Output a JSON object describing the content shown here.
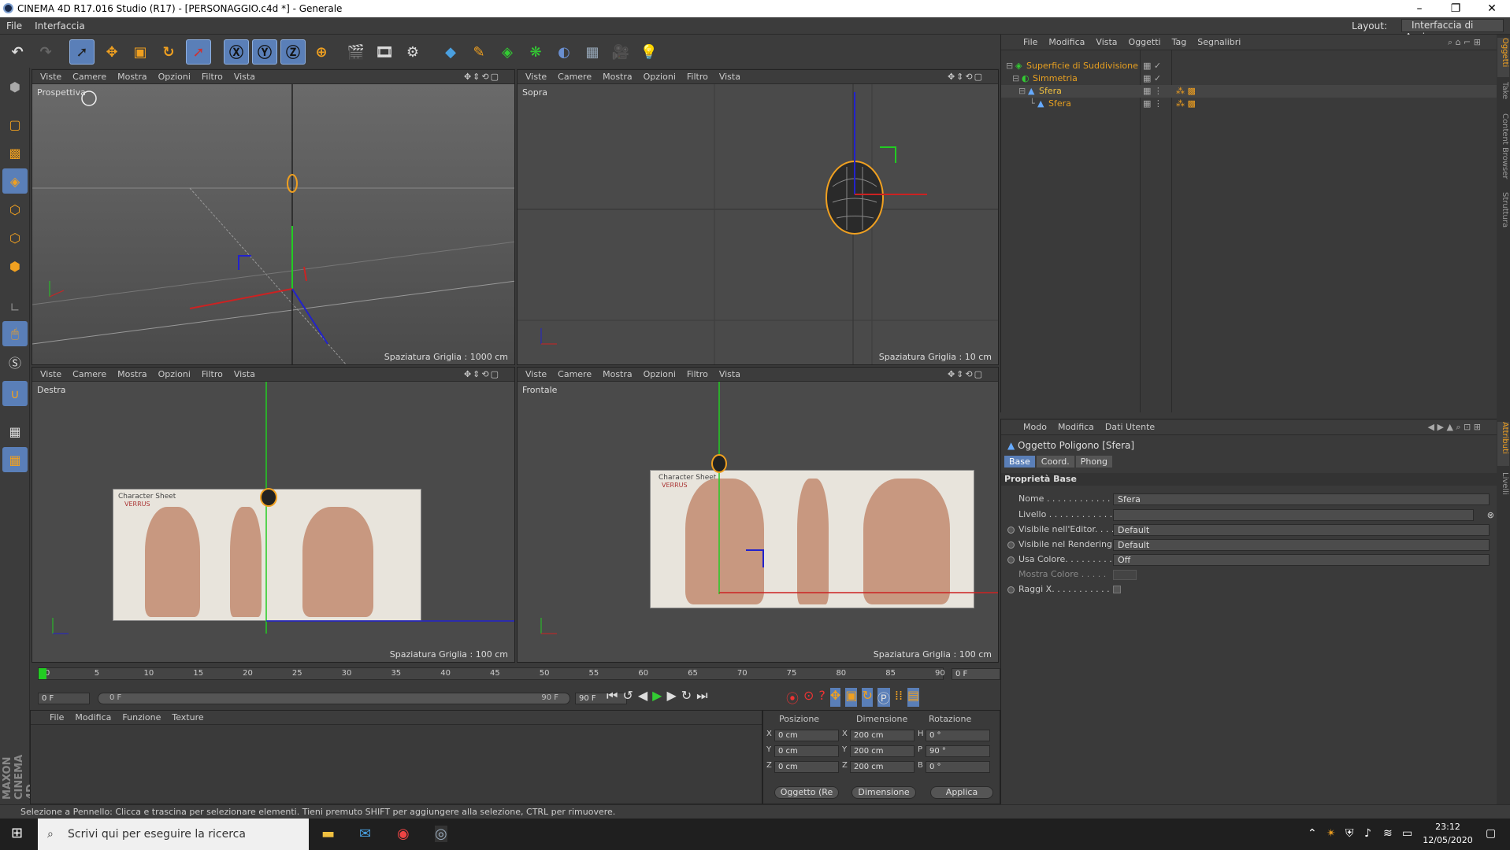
{
  "window": {
    "title": "CINEMA 4D R17.016 Studio (R17) - [PERSONAGGIO.c4d *] - Generale"
  },
  "menubar": {
    "items": [
      "File",
      "Interfaccia"
    ],
    "layout_label": "Layout:",
    "layout_value": "Interfaccia di Avvio"
  },
  "viewport_menu": [
    "Viste",
    "Camere",
    "Mostra",
    "Opzioni",
    "Filtro",
    "Vista"
  ],
  "viewports": {
    "tl": {
      "name": "Prospettiva",
      "grid": "Spaziatura Griglia : 1000 cm"
    },
    "tr": {
      "name": "Sopra",
      "grid": "Spaziatura Griglia : 10 cm"
    },
    "bl": {
      "name": "Destra",
      "grid": "Spaziatura Griglia : 100 cm"
    },
    "br": {
      "name": "Frontale",
      "grid": "Spaziatura Griglia : 100 cm"
    }
  },
  "objects_menu": [
    "File",
    "Modifica",
    "Vista",
    "Oggetti",
    "Tag",
    "Segnalibri"
  ],
  "objects": [
    {
      "name": "Superficie di Suddivisione",
      "color": "#e8a020",
      "indent": 0
    },
    {
      "name": "Simmetria",
      "color": "#e8a020",
      "indent": 1
    },
    {
      "name": "Sfera",
      "color": "#f0c040",
      "indent": 2
    },
    {
      "name": "Sfera",
      "color": "#e8a020",
      "indent": 3
    }
  ],
  "right_tabs": [
    "Oggetti",
    "Take",
    "Content Browser",
    "Struttura",
    "Attributi",
    "Livelli"
  ],
  "attr_menu": [
    "Modo",
    "Modifica",
    "Dati Utente"
  ],
  "attr": {
    "title": "Oggetto Poligono [Sfera]",
    "tabs": [
      "Base",
      "Coord.",
      "Phong"
    ],
    "section": "Proprietà Base",
    "rows": [
      {
        "label": "Nome . . . . . . . . . . . . . . .",
        "value": "Sfera"
      },
      {
        "label": "Livello . . . . . . . . . . . . . .",
        "value": ""
      },
      {
        "label": "Visibile nell'Editor. . . .",
        "value": "Default"
      },
      {
        "label": "Visibile nel Rendering",
        "value": "Default"
      },
      {
        "label": "Usa Colore. . . . . . . . . .",
        "value": "Off"
      },
      {
        "label": "Mostra Colore . . . . .",
        "value": ""
      },
      {
        "label": "Raggi X. . . . . . . . . . . . .",
        "value": ""
      }
    ]
  },
  "timeline": {
    "ticks": [
      "0",
      "5",
      "10",
      "15",
      "20",
      "25",
      "30",
      "35",
      "40",
      "45",
      "50",
      "55",
      "60",
      "65",
      "70",
      "75",
      "80",
      "85",
      "90"
    ],
    "current": "0 F",
    "start": "0 F",
    "range_start": "0 F",
    "range_end": "90 F",
    "end": "90 F"
  },
  "materials_menu": [
    "File",
    "Modifica",
    "Funzione",
    "Texture"
  ],
  "coords": {
    "headers": [
      "Posizione",
      "Dimensione",
      "Rotazione"
    ],
    "rows": [
      {
        "axis": "X",
        "pos": "0 cm",
        "daxis": "X",
        "dim": "200 cm",
        "raxis": "H",
        "rot": "0 °"
      },
      {
        "axis": "Y",
        "pos": "0 cm",
        "daxis": "Y",
        "dim": "200 cm",
        "raxis": "P",
        "rot": "90 °"
      },
      {
        "axis": "Z",
        "pos": "0 cm",
        "daxis": "Z",
        "dim": "200 cm",
        "raxis": "B",
        "rot": "0 °"
      }
    ],
    "mode": "Oggetto (Re",
    "size_mode": "Dimensione",
    "apply": "Applica"
  },
  "status": "Selezione a Pennello: Clicca e trascina per selezionare elementi. Tieni premuto SHIFT per aggiungere alla selezione, CTRL per rimuovere.",
  "taskbar": {
    "search": "Scrivi qui per eseguire la ricerca",
    "time": "23:12",
    "date": "12/05/2020"
  },
  "logo": "MAXON CINEMA 4D",
  "sheet": {
    "title": "Character Sheet",
    "subtitle": "VERRUS"
  }
}
